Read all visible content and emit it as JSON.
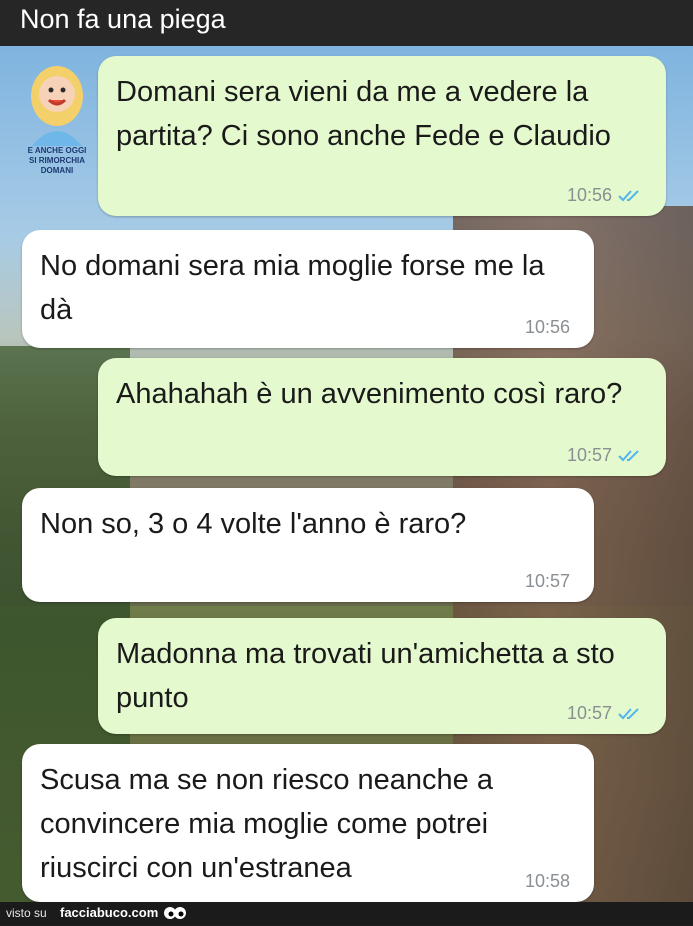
{
  "header": {
    "title": "Non fa una piega"
  },
  "avatar": {
    "caption_line1": "E anche oggi",
    "caption_line2": "si rimorchia domani"
  },
  "messages": [
    {
      "direction": "outgoing",
      "text": "Domani sera vieni da me a vedere la partita? Ci sono anche Fede e Claudio",
      "time": "10:56",
      "read_icon": "double-check-icon"
    },
    {
      "direction": "incoming",
      "text": "No domani sera mia moglie forse me la dà",
      "time": "10:56"
    },
    {
      "direction": "outgoing",
      "text": "Ahahahah è un avvenimento così raro?",
      "time": "10:57",
      "read_icon": "double-check-icon"
    },
    {
      "direction": "incoming",
      "text": "Non so, 3 o 4 volte l'anno è raro?",
      "time": "10:57"
    },
    {
      "direction": "outgoing",
      "text": "Madonna ma trovati un'amichetta a sto punto",
      "time": "10:57",
      "read_icon": "double-check-icon"
    },
    {
      "direction": "incoming",
      "text": "Scusa ma se non riesco neanche a convincere mia moglie come potrei riuscirci con un'estranea",
      "time": "10:58"
    }
  ],
  "footer": {
    "visto_su": "visto su",
    "site": "facciabuco.com"
  },
  "colors": {
    "outgoing_bubble": "#e4f9cd",
    "incoming_bubble": "#ffffff",
    "tick_blue": "#4fb6ec",
    "time_gray": "#8a8f93"
  }
}
